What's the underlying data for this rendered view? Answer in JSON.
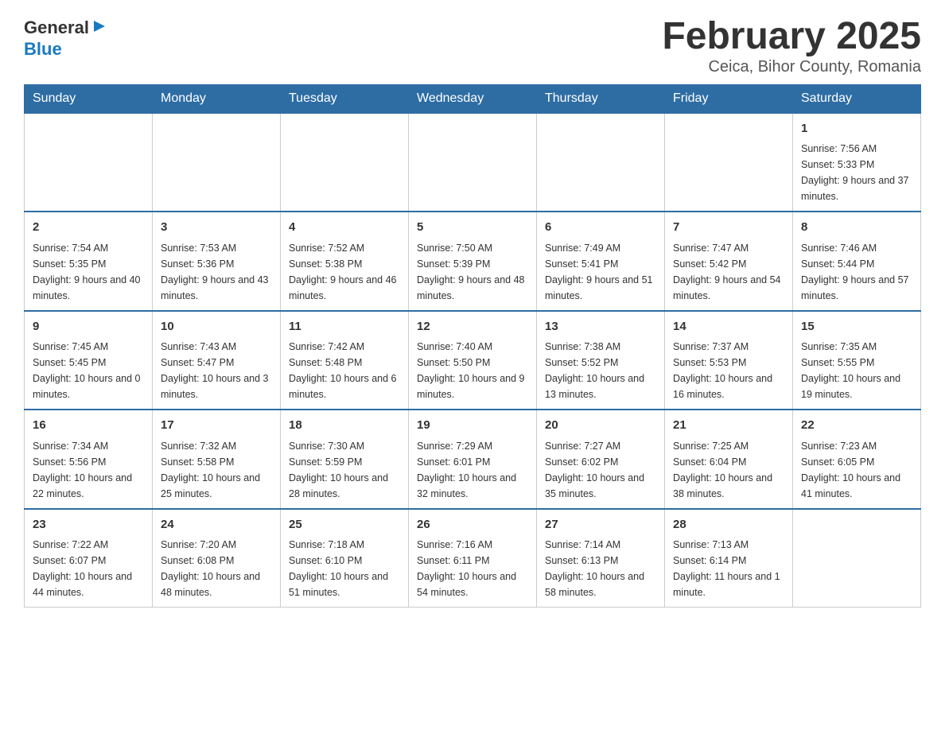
{
  "header": {
    "logo_general": "General",
    "logo_blue": "Blue",
    "title": "February 2025",
    "subtitle": "Ceica, Bihor County, Romania"
  },
  "calendar": {
    "days_of_week": [
      "Sunday",
      "Monday",
      "Tuesday",
      "Wednesday",
      "Thursday",
      "Friday",
      "Saturday"
    ],
    "weeks": [
      [
        {
          "day": "",
          "info": ""
        },
        {
          "day": "",
          "info": ""
        },
        {
          "day": "",
          "info": ""
        },
        {
          "day": "",
          "info": ""
        },
        {
          "day": "",
          "info": ""
        },
        {
          "day": "",
          "info": ""
        },
        {
          "day": "1",
          "info": "Sunrise: 7:56 AM\nSunset: 5:33 PM\nDaylight: 9 hours and 37 minutes."
        }
      ],
      [
        {
          "day": "2",
          "info": "Sunrise: 7:54 AM\nSunset: 5:35 PM\nDaylight: 9 hours and 40 minutes."
        },
        {
          "day": "3",
          "info": "Sunrise: 7:53 AM\nSunset: 5:36 PM\nDaylight: 9 hours and 43 minutes."
        },
        {
          "day": "4",
          "info": "Sunrise: 7:52 AM\nSunset: 5:38 PM\nDaylight: 9 hours and 46 minutes."
        },
        {
          "day": "5",
          "info": "Sunrise: 7:50 AM\nSunset: 5:39 PM\nDaylight: 9 hours and 48 minutes."
        },
        {
          "day": "6",
          "info": "Sunrise: 7:49 AM\nSunset: 5:41 PM\nDaylight: 9 hours and 51 minutes."
        },
        {
          "day": "7",
          "info": "Sunrise: 7:47 AM\nSunset: 5:42 PM\nDaylight: 9 hours and 54 minutes."
        },
        {
          "day": "8",
          "info": "Sunrise: 7:46 AM\nSunset: 5:44 PM\nDaylight: 9 hours and 57 minutes."
        }
      ],
      [
        {
          "day": "9",
          "info": "Sunrise: 7:45 AM\nSunset: 5:45 PM\nDaylight: 10 hours and 0 minutes."
        },
        {
          "day": "10",
          "info": "Sunrise: 7:43 AM\nSunset: 5:47 PM\nDaylight: 10 hours and 3 minutes."
        },
        {
          "day": "11",
          "info": "Sunrise: 7:42 AM\nSunset: 5:48 PM\nDaylight: 10 hours and 6 minutes."
        },
        {
          "day": "12",
          "info": "Sunrise: 7:40 AM\nSunset: 5:50 PM\nDaylight: 10 hours and 9 minutes."
        },
        {
          "day": "13",
          "info": "Sunrise: 7:38 AM\nSunset: 5:52 PM\nDaylight: 10 hours and 13 minutes."
        },
        {
          "day": "14",
          "info": "Sunrise: 7:37 AM\nSunset: 5:53 PM\nDaylight: 10 hours and 16 minutes."
        },
        {
          "day": "15",
          "info": "Sunrise: 7:35 AM\nSunset: 5:55 PM\nDaylight: 10 hours and 19 minutes."
        }
      ],
      [
        {
          "day": "16",
          "info": "Sunrise: 7:34 AM\nSunset: 5:56 PM\nDaylight: 10 hours and 22 minutes."
        },
        {
          "day": "17",
          "info": "Sunrise: 7:32 AM\nSunset: 5:58 PM\nDaylight: 10 hours and 25 minutes."
        },
        {
          "day": "18",
          "info": "Sunrise: 7:30 AM\nSunset: 5:59 PM\nDaylight: 10 hours and 28 minutes."
        },
        {
          "day": "19",
          "info": "Sunrise: 7:29 AM\nSunset: 6:01 PM\nDaylight: 10 hours and 32 minutes."
        },
        {
          "day": "20",
          "info": "Sunrise: 7:27 AM\nSunset: 6:02 PM\nDaylight: 10 hours and 35 minutes."
        },
        {
          "day": "21",
          "info": "Sunrise: 7:25 AM\nSunset: 6:04 PM\nDaylight: 10 hours and 38 minutes."
        },
        {
          "day": "22",
          "info": "Sunrise: 7:23 AM\nSunset: 6:05 PM\nDaylight: 10 hours and 41 minutes."
        }
      ],
      [
        {
          "day": "23",
          "info": "Sunrise: 7:22 AM\nSunset: 6:07 PM\nDaylight: 10 hours and 44 minutes."
        },
        {
          "day": "24",
          "info": "Sunrise: 7:20 AM\nSunset: 6:08 PM\nDaylight: 10 hours and 48 minutes."
        },
        {
          "day": "25",
          "info": "Sunrise: 7:18 AM\nSunset: 6:10 PM\nDaylight: 10 hours and 51 minutes."
        },
        {
          "day": "26",
          "info": "Sunrise: 7:16 AM\nSunset: 6:11 PM\nDaylight: 10 hours and 54 minutes."
        },
        {
          "day": "27",
          "info": "Sunrise: 7:14 AM\nSunset: 6:13 PM\nDaylight: 10 hours and 58 minutes."
        },
        {
          "day": "28",
          "info": "Sunrise: 7:13 AM\nSunset: 6:14 PM\nDaylight: 11 hours and 1 minute."
        },
        {
          "day": "",
          "info": ""
        }
      ]
    ]
  }
}
